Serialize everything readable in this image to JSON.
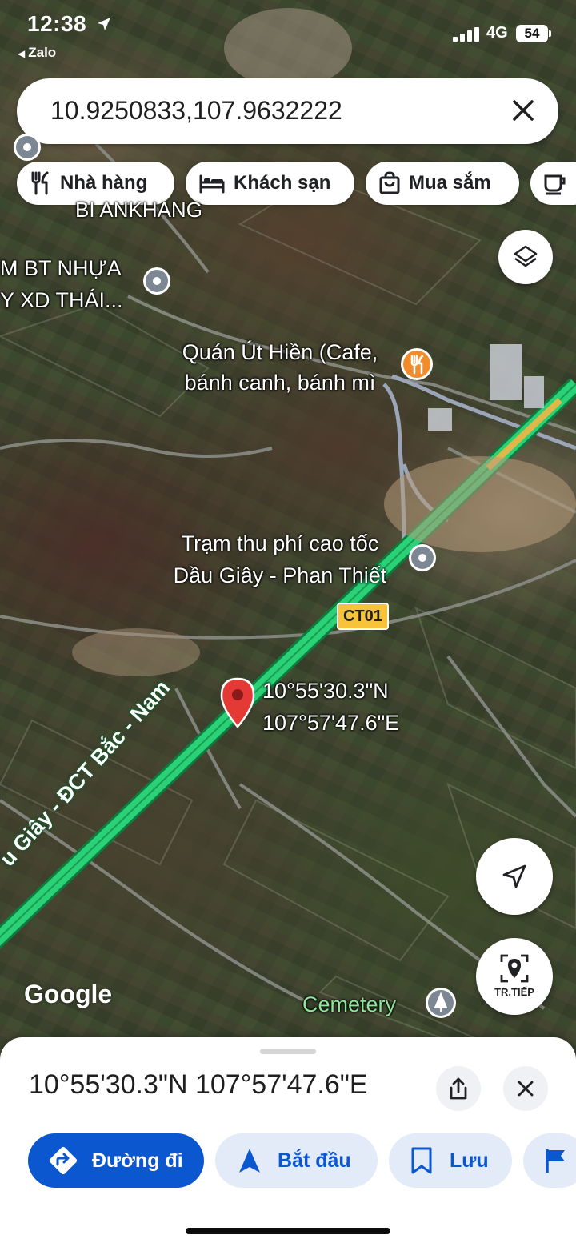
{
  "status_bar": {
    "time": "12:38",
    "back_app": "Zalo",
    "network": "4G",
    "battery": "54"
  },
  "search": {
    "query": "10.9250833,107.9632222"
  },
  "chips": [
    {
      "label": "Nhà hàng",
      "icon": "fork-knife-icon"
    },
    {
      "label": "Khách sạn",
      "icon": "bed-icon"
    },
    {
      "label": "Mua sắm",
      "icon": "shopping-bag-icon"
    },
    {
      "label": "",
      "icon": "coffee-cup-icon"
    }
  ],
  "map": {
    "labels": {
      "place_top_a": "BI ANKHANG",
      "place_plant_1": "M BT NHỰA",
      "place_plant_2": "Y XD THÁI...",
      "cafe_1": "Quán Út Hiền (Cafe,",
      "cafe_2": "bánh canh, bánh mì",
      "toll_1": "Trạm thu phí cao tốc",
      "toll_2": "Dầu Giây - Phan Thiết",
      "route_shield": "CT01",
      "pin_lat": "10°55'30.3\"N",
      "pin_lng": "107°57'47.6\"E",
      "highway_name": "u Giây - ĐCT Bắc - Nam",
      "cemetery": "Cemetery",
      "google": "Google"
    },
    "live_view_label": "TR.TIẾP",
    "colors": {
      "highway": "#1fbf6b",
      "pin_red": "#e53935",
      "cafe_orange": "#f28b2a"
    }
  },
  "sheet": {
    "title": "10°55'30.3\"N 107°57'47.6\"E",
    "actions": [
      {
        "label": "Đường đi",
        "icon": "directions-icon"
      },
      {
        "label": "Bắt đầu",
        "icon": "navigation-arrow-icon"
      },
      {
        "label": "Lưu",
        "icon": "bookmark-icon"
      },
      {
        "label": "",
        "icon": "flag-icon"
      }
    ]
  }
}
